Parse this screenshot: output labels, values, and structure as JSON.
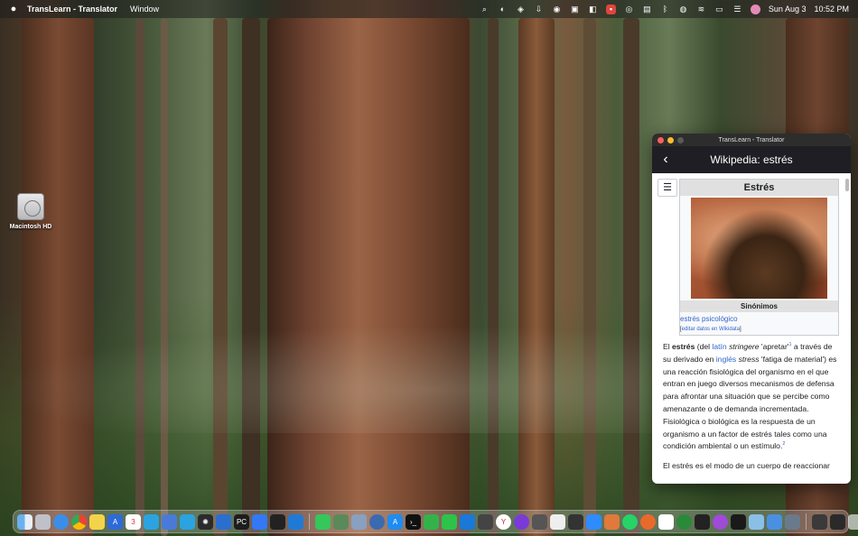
{
  "menubar": {
    "app_name": "TransLearn - Translator",
    "menus": [
      "Window"
    ],
    "date": "Sun Aug 3",
    "time": "10:52 PM"
  },
  "desktop": {
    "drive_label": "Macintosh HD"
  },
  "window": {
    "title": "TransLearn - Translator",
    "nav_title": "Wikipedia: estrés",
    "back_icon": "chevron-left-icon"
  },
  "infobox": {
    "title": "Estrés",
    "synonyms_header": "Sinónimos",
    "synonym": "estrés psicológico",
    "edit_prefix": "[",
    "edit_link": "editar datos en Wikidata",
    "edit_suffix": "]"
  },
  "article": {
    "p1": {
      "t1": "El ",
      "b1": "estrés",
      "t2": " (del ",
      "l1": "latín",
      "t3": " ",
      "i1": "stringere",
      "t4": " 'apretar'",
      "sup1": "1",
      "t5": "  a través de su derivado en ",
      "l2": "inglés",
      "t6": " ",
      "i2": "stress",
      "t7": " 'fatiga de material') es una reacción fisiológica del organismo en el que entran en juego diversos mecanismos de defensa para afrontar una situación que se percibe como amenazante o de demanda incrementada. Fisiológica o biológica es la respuesta de un organismo a un factor de estrés tales como una condición ambiental o un estímulo.",
      "sup2": "2"
    },
    "p2": "El estrés es el modo de un cuerpo de reaccionar"
  },
  "colors": {
    "link": "#3366cc",
    "nav_bg": "#1e1e24",
    "titlebar_bg": "#2d2d2d"
  }
}
